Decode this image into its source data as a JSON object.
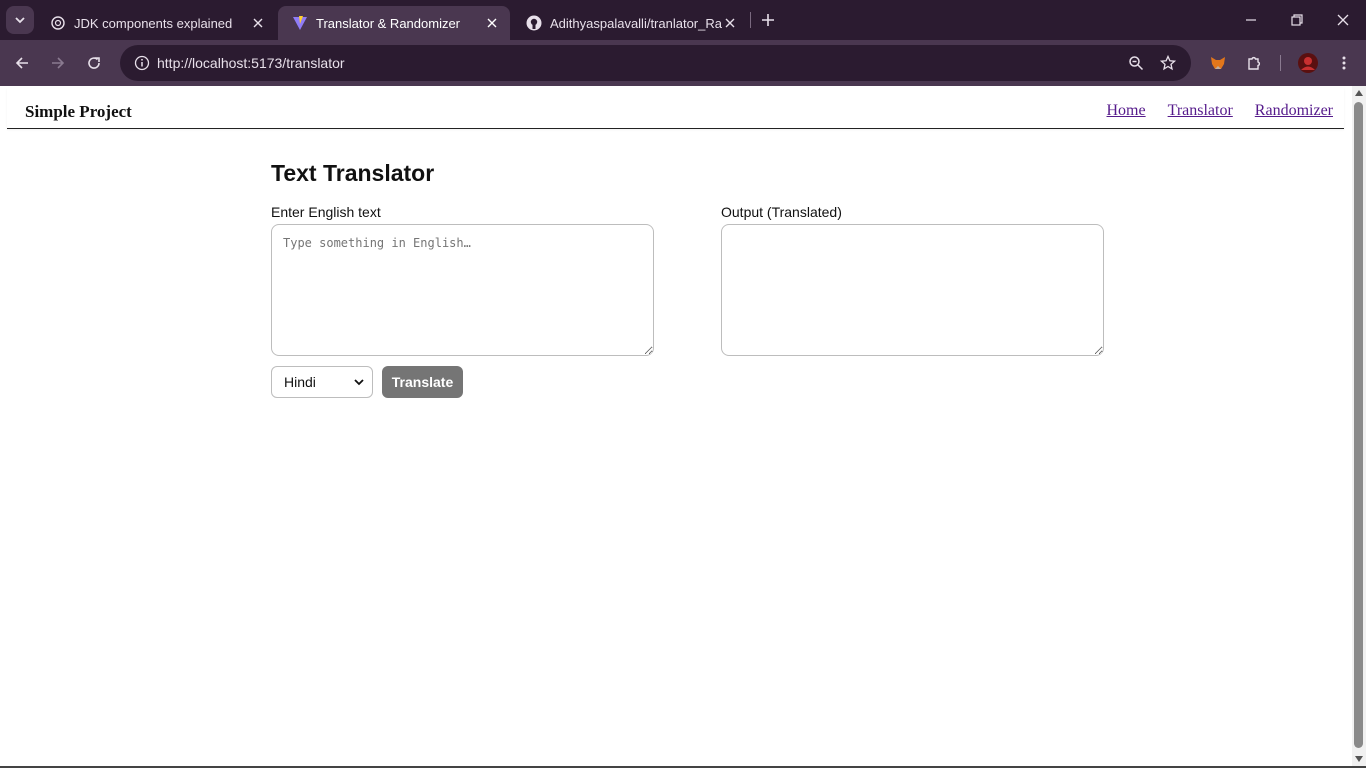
{
  "browser": {
    "tabs": [
      {
        "title": "JDK components explained",
        "icon": "openai-icon"
      },
      {
        "title": "Translator & Randomizer",
        "icon": "vite-icon",
        "active": true
      },
      {
        "title": "Adithyaspalavalli/tranlator_Randomizer",
        "icon": "github-icon"
      }
    ],
    "url": "http://localhost:5173/translator"
  },
  "navbar": {
    "brand": "Simple Project",
    "links": [
      "Home",
      "Translator",
      "Randomizer"
    ]
  },
  "translator": {
    "title": "Text Translator",
    "input_label": "Enter English text",
    "input_placeholder": "Type something in English…",
    "output_label": "Output (Translated)",
    "output_value": "",
    "language_selected": "Hindi",
    "translate_label": "Translate"
  },
  "colors": {
    "chrome_dark": "#2b1b30",
    "chrome_toolbar": "#4a3750",
    "link_visited": "#551a8b",
    "button_gray": "#757575"
  }
}
